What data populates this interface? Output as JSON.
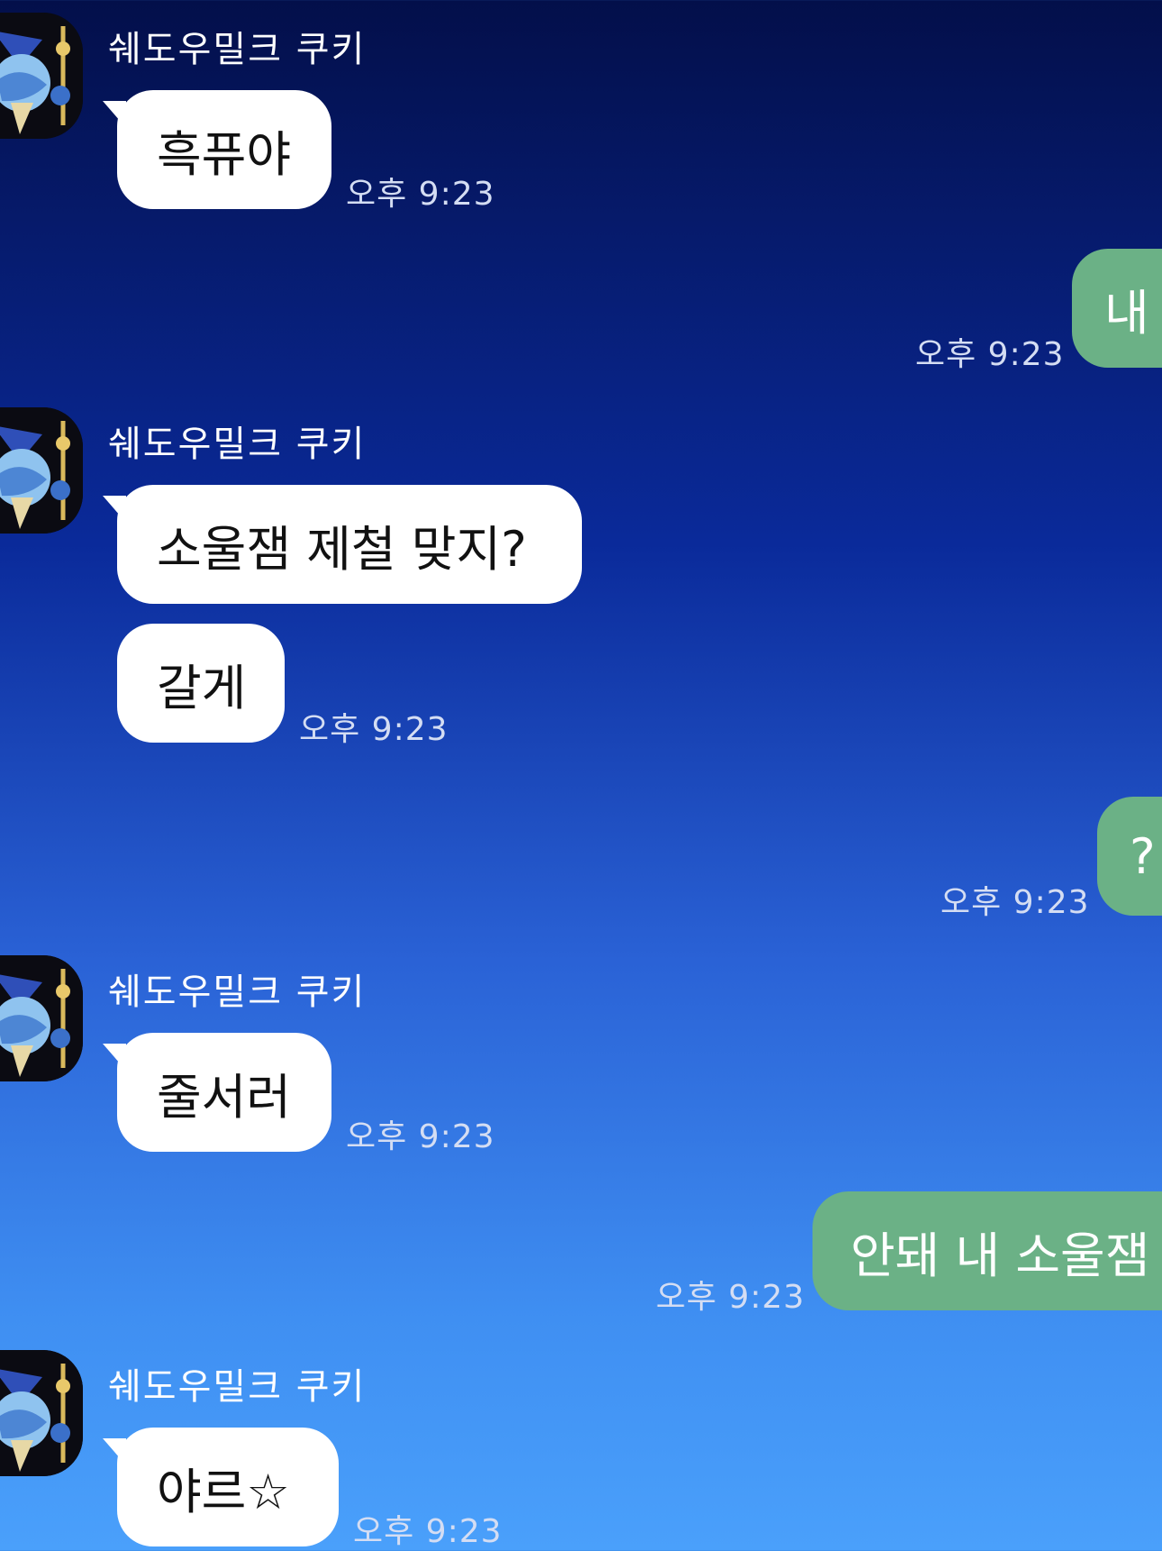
{
  "chat": {
    "contact_name": "쉐도우밀크 쿠키",
    "messages": [
      {
        "from": "them",
        "text": "흑퓨야",
        "time": "오후 9:23"
      },
      {
        "from": "me",
        "text": "내",
        "time": "오후 9:23"
      },
      {
        "from": "them",
        "text": "소울잼 제철 맞지?"
      },
      {
        "from": "them",
        "text": "갈게",
        "time": "오후 9:23"
      },
      {
        "from": "me",
        "text": "?",
        "time": "오후 9:23"
      },
      {
        "from": "them",
        "text": "줄서러",
        "time": "오후 9:23"
      },
      {
        "from": "me",
        "text": "안돼 내 소울잼",
        "time": "오후 9:23"
      },
      {
        "from": "them",
        "text": "야르☆",
        "time": "오후 9:23"
      }
    ]
  },
  "colors": {
    "incoming_bubble": "#ffffff",
    "outgoing_bubble": "#6bb186",
    "background_top": "#030f4a",
    "background_bottom": "#4aa0fb"
  },
  "icons": {
    "avatar": "shadow-milk-cookie-avatar-icon"
  }
}
